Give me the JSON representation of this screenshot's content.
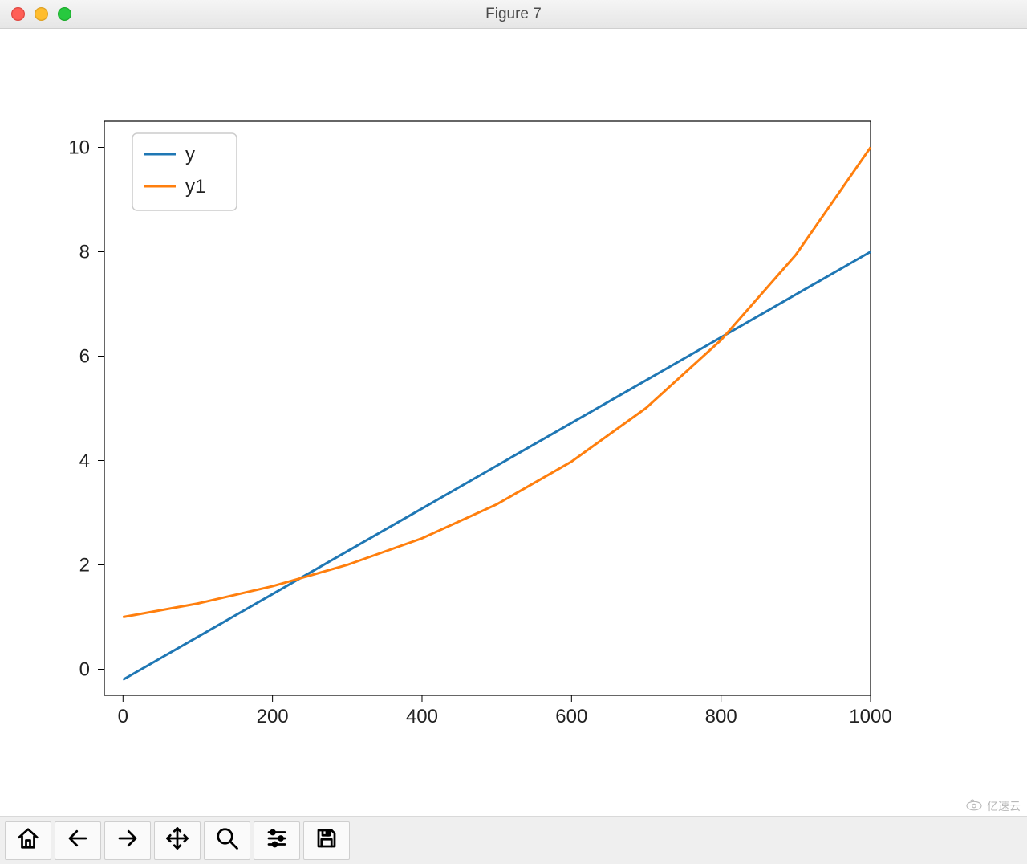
{
  "window": {
    "title": "Figure 7"
  },
  "toolbar": {
    "home": "Home",
    "back": "Back",
    "forward": "Forward",
    "pan": "Pan",
    "zoom": "Zoom",
    "configure": "Configure subplots",
    "save": "Save"
  },
  "watermark": {
    "text": "亿速云"
  },
  "chart_data": {
    "type": "line",
    "x": [
      0,
      100,
      200,
      300,
      400,
      500,
      600,
      700,
      800,
      900,
      1000
    ],
    "series": [
      {
        "name": "y",
        "values": [
          -0.2,
          0.62,
          1.44,
          2.26,
          3.08,
          3.9,
          4.72,
          5.54,
          6.36,
          7.18,
          8.0
        ],
        "color": "#1f77b4"
      },
      {
        "name": "y1",
        "values": [
          1.0,
          1.26,
          1.59,
          2.0,
          2.51,
          3.16,
          3.98,
          5.01,
          6.31,
          7.94,
          10.0
        ],
        "color": "#ff7f0e"
      }
    ],
    "xticks": [
      0,
      200,
      400,
      600,
      800,
      1000
    ],
    "yticks": [
      0,
      2,
      4,
      6,
      8,
      10
    ],
    "xlim": [
      -25,
      1000
    ],
    "ylim": [
      -0.5,
      10.5
    ],
    "legend_position": "upper left"
  }
}
